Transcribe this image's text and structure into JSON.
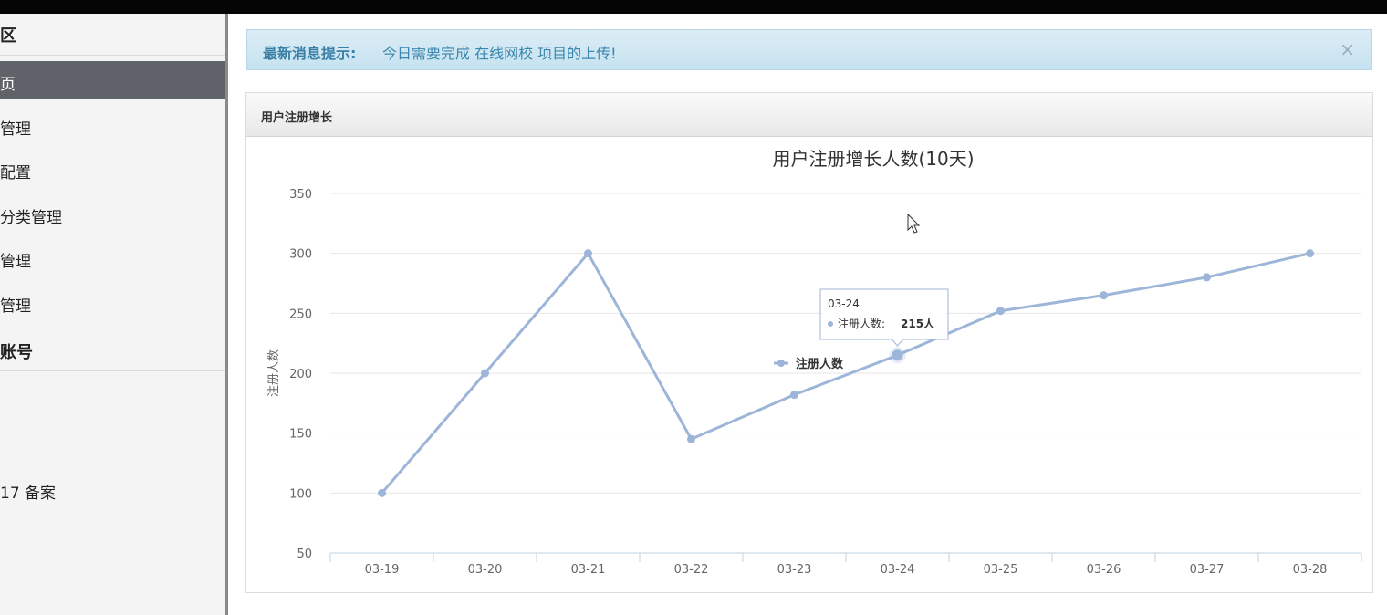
{
  "sidebar": {
    "section1_title": "区",
    "items": [
      "页",
      "管理",
      "配置",
      "分类管理",
      "管理",
      "管理"
    ],
    "section2_title": "账号",
    "footer_text": "17 备案"
  },
  "alert": {
    "label": "最新消息提示:",
    "text": "今日需要完成 在线网校 项目的上传!",
    "close": "×"
  },
  "panel": {
    "title": "用户注册增长"
  },
  "tooltip": {
    "date": "03-24",
    "series": "注册人数:",
    "value": "215人"
  },
  "chart_data": {
    "type": "line",
    "title": "用户注册增长人数(10天)",
    "ylabel": "注册人数",
    "xlabel": "",
    "categories": [
      "03-19",
      "03-20",
      "03-21",
      "03-22",
      "03-23",
      "03-24",
      "03-25",
      "03-26",
      "03-27",
      "03-28"
    ],
    "series": [
      {
        "name": "注册人数",
        "values": [
          100,
          200,
          300,
          145,
          182,
          215,
          252,
          265,
          280,
          300
        ],
        "color": "#9db5d8"
      }
    ],
    "ylim": [
      50,
      350
    ],
    "yticks": [
      50,
      100,
      150,
      200,
      250,
      300,
      350
    ],
    "grid": true,
    "legend": "center"
  }
}
